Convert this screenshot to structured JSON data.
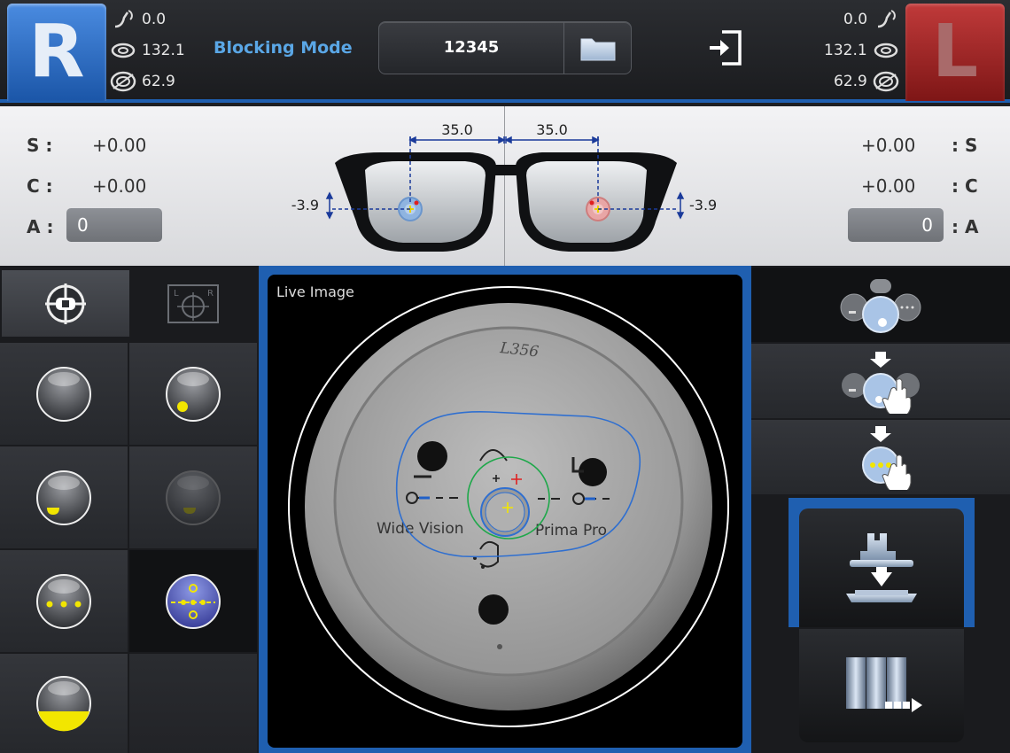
{
  "header": {
    "right_eye_label": "R",
    "left_eye_label": "L",
    "mode": "Blocking Mode",
    "job_number": "12345",
    "right_stats": [
      {
        "icon": "bevel-icon",
        "value": "0.0"
      },
      {
        "icon": "rotation-icon",
        "value": "132.1"
      },
      {
        "icon": "size-icon",
        "value": "62.9"
      }
    ],
    "left_stats": [
      {
        "icon": "bevel-icon",
        "value": "0.0"
      },
      {
        "icon": "rotation-icon",
        "value": "132.1"
      },
      {
        "icon": "size-icon",
        "value": "62.9"
      }
    ]
  },
  "rx": {
    "right": {
      "sphere_label": "S :",
      "sphere": "+0.00",
      "cylinder_label": "C :",
      "cylinder": "+0.00",
      "axis_label": "A :",
      "axis": "0"
    },
    "left": {
      "sphere_label": ": S",
      "sphere": "+0.00",
      "cylinder_label": ": C",
      "cylinder": "+0.00",
      "axis_label": ": A",
      "axis": "0"
    },
    "glasses": {
      "pd_right": "35.0",
      "pd_left": "35.0",
      "height_right": "-3.9",
      "height_left": "-3.9"
    }
  },
  "live": {
    "title": "Live Image",
    "lens_text_left": "Wide Vision",
    "lens_text_right": "Prima Pro",
    "lens_marking": "L356"
  },
  "colors": {
    "accent_blue": "#1f5fb0",
    "right_eye": "#2a6cc6",
    "left_eye": "#9e2424",
    "mode_text": "#5aa7e6",
    "yellow_marker": "#f2e600",
    "outline_blue": "#2f6fd0",
    "outline_green": "#1ea84a"
  }
}
